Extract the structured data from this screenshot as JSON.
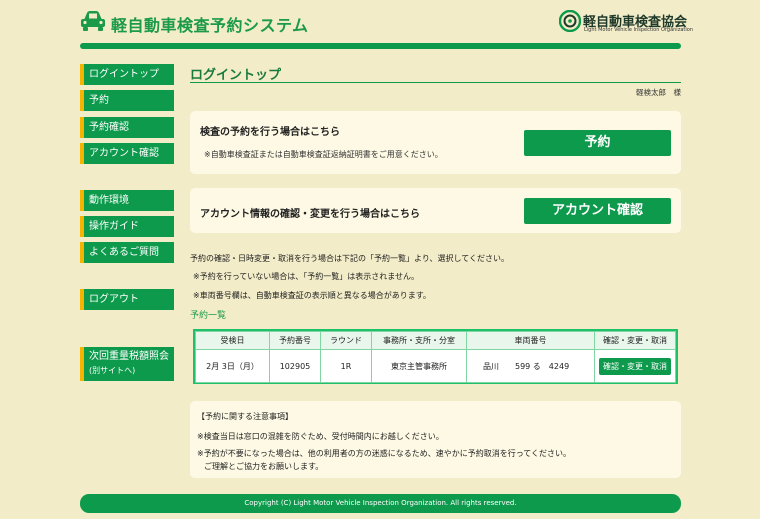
{
  "header": {
    "site_title": "軽自動車検査予約システム",
    "org_name": "軽自動車検査協会",
    "org_name_en": "Light Motor Vehicle Inspection Organization"
  },
  "sidebar": {
    "items": [
      {
        "label": "ログイントップ"
      },
      {
        "label": "予約"
      },
      {
        "label": "予約確認"
      },
      {
        "label": "アカウント確認"
      },
      {
        "label": "動作環境"
      },
      {
        "label": "操作ガイド"
      },
      {
        "label": "よくあるご質問"
      },
      {
        "label": "ログアウト"
      },
      {
        "label": "次回重量税額照会",
        "sub": "(別サイトへ)"
      }
    ]
  },
  "main": {
    "title": "ログイントップ",
    "user": "軽検太郎　様",
    "reserve_panel": {
      "heading": "検査の予約を行う場合はこちら",
      "note": "※自動車検査証または自動車検査証返納証明書をご用意ください。",
      "button": "予約"
    },
    "account_panel": {
      "heading": "アカウント情報の確認・変更を行う場合はこちら",
      "button": "アカウント確認"
    },
    "info": [
      "予約の確認・日時変更・取消を行う場合は下記の「予約一覧」より、選択してください。",
      "※予約を行っていない場合は、「予約一覧」は表示されません。",
      "※車両番号欄は、自動車検査証の表示順と異なる場合があります。"
    ],
    "list_link": "予約一覧",
    "table": {
      "headers": [
        "受検日",
        "予約番号",
        "ラウンド",
        "事務所・支所・分室",
        "車両番号",
        "確認・変更・取消"
      ],
      "rows": [
        {
          "date": "2月 3日（月）",
          "number": "102905",
          "round": "1R",
          "office": "東京主管事務所",
          "plate": "品川　　599 る　4249",
          "action": "確認・変更・取消"
        }
      ]
    },
    "notice": {
      "title": "【予約に関する注意事項】",
      "lines": [
        "※検査当日は窓口の混雑を防ぐため、受付時間内にお越しください。",
        "※予約が不要になった場合は、他の利用者の方の迷惑になるため、速やかに予約取消を行ってください。",
        "ご理解とご協力をお願いします。"
      ]
    }
  },
  "footer": {
    "copyright": "Copyright (C) Light Motor Vehicle Inspection Organization. All rights reserved."
  },
  "colors": {
    "primary_green": "#0d9a4c",
    "nav_accent": "#f5b400",
    "background": "#f2ecc8",
    "panel": "#fdf9e4"
  }
}
